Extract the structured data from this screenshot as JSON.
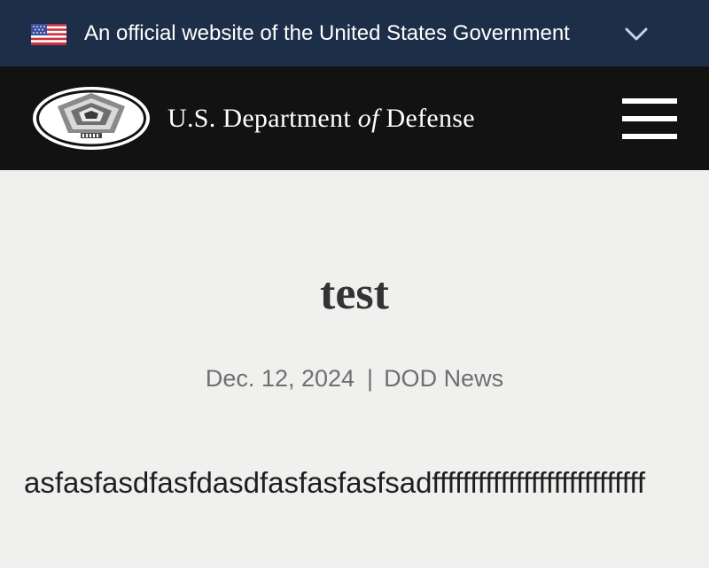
{
  "gov_banner": {
    "text": "An official website of the United States Government",
    "flag_icon": "us-flag-icon",
    "toggle_icon": "chevron-down-icon"
  },
  "header": {
    "site_title_pre": "U.S. Department ",
    "site_title_of": "of",
    "site_title_post": " Defense",
    "logo_icon": "pentagon-seal-icon",
    "menu_icon": "hamburger-menu-icon"
  },
  "article": {
    "title": "test",
    "date": "Dec. 12, 2024",
    "separator": "|",
    "category": "DOD News",
    "body": "asfasfasdfasfdasdfasfasfasfsadffffffffffffffffffffffffffff"
  },
  "colors": {
    "gov_banner_bg": "#1d2e48",
    "header_bg": "#121212",
    "page_bg": "#f0f0ef"
  }
}
